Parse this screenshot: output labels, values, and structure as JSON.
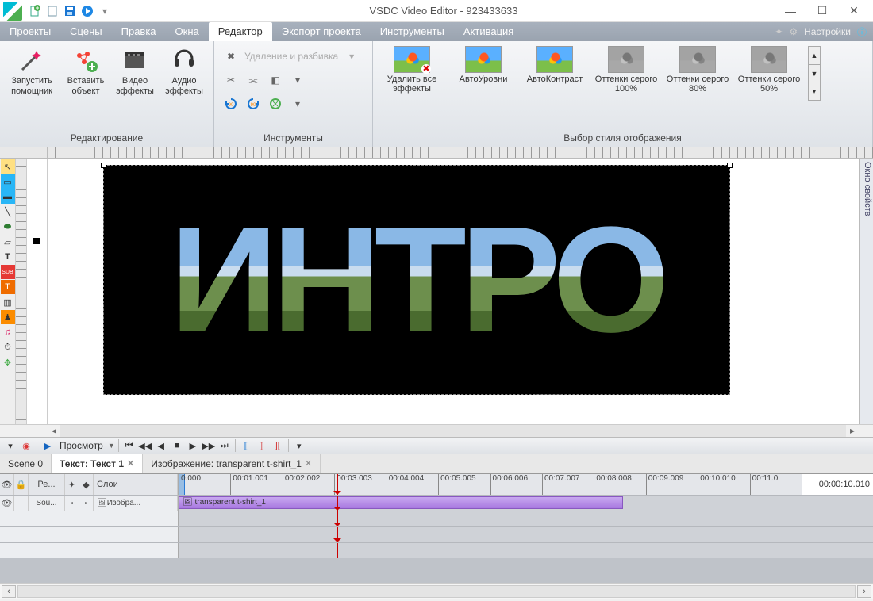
{
  "app_title": "VSDC Video Editor - 923433633",
  "settings_label": "Настройки",
  "menu": [
    "Проекты",
    "Сцены",
    "Правка",
    "Окна",
    "Редактор",
    "Экспорт проекта",
    "Инструменты",
    "Активация"
  ],
  "menu_active_index": 4,
  "ribbon": {
    "edit_group": "Редактирование",
    "tools_group": "Инструменты",
    "style_group": "Выбор стиля отображения",
    "wizard": "Запустить помощник",
    "insert": "Вставить объект",
    "video_fx": "Видео эффекты",
    "audio_fx": "Аудио эффекты",
    "delete_split": "Удаление и разбивка",
    "styles": [
      {
        "label": "Удалить все эффекты",
        "del": true
      },
      {
        "label": "АвтоУровни"
      },
      {
        "label": "АвтоКонтраст"
      },
      {
        "label": "Оттенки серого 100%",
        "gray": true
      },
      {
        "label": "Оттенки серого 80%",
        "gray": true
      },
      {
        "label": "Оттенки серого 50%",
        "gray": true
      }
    ]
  },
  "canvas_text": "ИНТРО",
  "properties_panel": "Окно свойств",
  "playback": {
    "preview": "Просмотр"
  },
  "tl_tabs": [
    {
      "label": "Scene 0",
      "active": false,
      "closable": false
    },
    {
      "label": "Текст: Текст 1",
      "active": true,
      "closable": true
    },
    {
      "label": "Изображение: transparent t-shirt_1",
      "active": false,
      "closable": true
    }
  ],
  "tl_left_headers": {
    "re": "Ре...",
    "layers": "Слои"
  },
  "tl_rows": [
    {
      "name": "Sou...",
      "track": "Изобра..."
    },
    {
      "clip": "transparent t-shirt_1"
    }
  ],
  "tl_ticks": [
    "0.000",
    "00:01.001",
    "00:02.002",
    "00:03.003",
    "00:04.004",
    "00:05.005",
    "00:06.006",
    "00:07.007",
    "00:08.008",
    "00:09.009",
    "00:10.010",
    "00:11.0"
  ],
  "tl_time": "00:00:10.010"
}
